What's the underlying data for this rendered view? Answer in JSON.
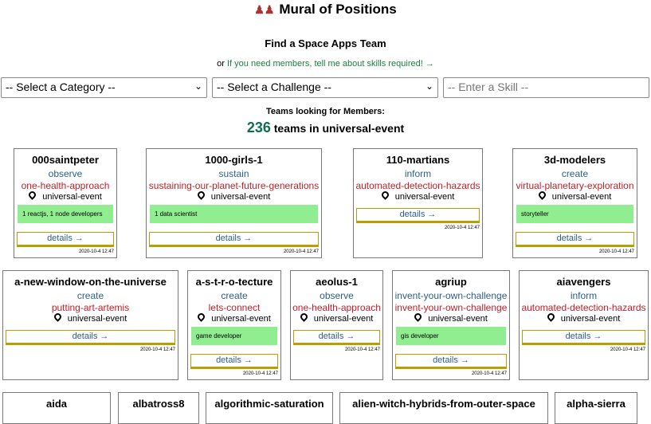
{
  "header": {
    "title": "Mural of Positions",
    "title_icon": "people-icon",
    "find_team": "Find a Space Apps Team",
    "or_text": "or",
    "members_link": "If you need members, tell me about skills required!",
    "arrow": "→"
  },
  "filters": {
    "category": "-- Select a Category --",
    "challenge": "-- Select a Challenge --",
    "skill_placeholder": "-- Enter a Skill --",
    "chevron": "⌄"
  },
  "summary": {
    "looking_label": "Teams looking for Members:",
    "count": "236",
    "count_suffix": "teams in universal-event"
  },
  "cards": [
    {
      "name": "000saintpeter",
      "subgroup": "observe",
      "challenge": "one-health-approach",
      "event": "universal-event",
      "skills": "1 reactjs, 1 node developers",
      "details": "details →",
      "date": "2020-10-4 12:47"
    },
    {
      "name": "1000-girls-1",
      "subgroup": "sustain",
      "challenge": "sustaining-our-planet-future-generations",
      "event": "universal-event",
      "skills": "1 data scientist",
      "details": "details →",
      "date": "2020-10-4 12:47"
    },
    {
      "name": "110-martians",
      "subgroup": "inform",
      "challenge": "automated-detection-hazards",
      "event": "universal-event",
      "skills": "",
      "details": "details →",
      "date": "2020-10-4 12:47"
    },
    {
      "name": "3d-modelers",
      "subgroup": "create",
      "challenge": "virtual-planetary-exploration",
      "event": "universal-event",
      "skills": "storyteller",
      "details": "details →",
      "date": "2020-10-4 12:47"
    },
    {
      "name": "a-new-window-on-the-universe",
      "subgroup": "create",
      "challenge": "putting-art-artemis",
      "event": "universal-event",
      "skills": "",
      "details": "details →",
      "date": "2020-10-4 12:47"
    },
    {
      "name": "a-s-t-r-o-tecture",
      "subgroup": "create",
      "challenge": "lets-connect",
      "event": "universal-event",
      "skills": "game developer",
      "details": "details →",
      "date": "2020-10-4 12:47"
    },
    {
      "name": "aeolus-1",
      "subgroup": "observe",
      "challenge": "one-health-approach",
      "event": "universal-event",
      "skills": "",
      "details": "details →",
      "date": "2020-10-4 12:47"
    },
    {
      "name": "agriup",
      "subgroup": "invent-your-own-challenge",
      "challenge": "invent-your-own-challenge",
      "event": "universal-event",
      "skills": "gis developer",
      "details": "details →",
      "date": "2020-10-4 12:47"
    },
    {
      "name": "aiavengers",
      "subgroup": "inform",
      "challenge": "automated-detection-hazards",
      "event": "universal-event",
      "skills": "",
      "details": "details →",
      "date": "2020-10-4 12:47"
    },
    {
      "name": "aida",
      "subgroup": "",
      "challenge": "",
      "event": "",
      "skills": "",
      "details": "",
      "date": ""
    },
    {
      "name": "albatross8",
      "subgroup": "",
      "challenge": "",
      "event": "",
      "skills": "",
      "details": "",
      "date": ""
    },
    {
      "name": "algorithmic-saturation",
      "subgroup": "",
      "challenge": "",
      "event": "",
      "skills": "",
      "details": "",
      "date": ""
    },
    {
      "name": "alien-witch-hybrids-from-outer-space",
      "subgroup": "",
      "challenge": "",
      "event": "",
      "skills": "",
      "details": "",
      "date": ""
    },
    {
      "name": "alpha-sierra",
      "subgroup": "",
      "challenge": "",
      "event": "",
      "skills": "",
      "details": "",
      "date": ""
    }
  ]
}
